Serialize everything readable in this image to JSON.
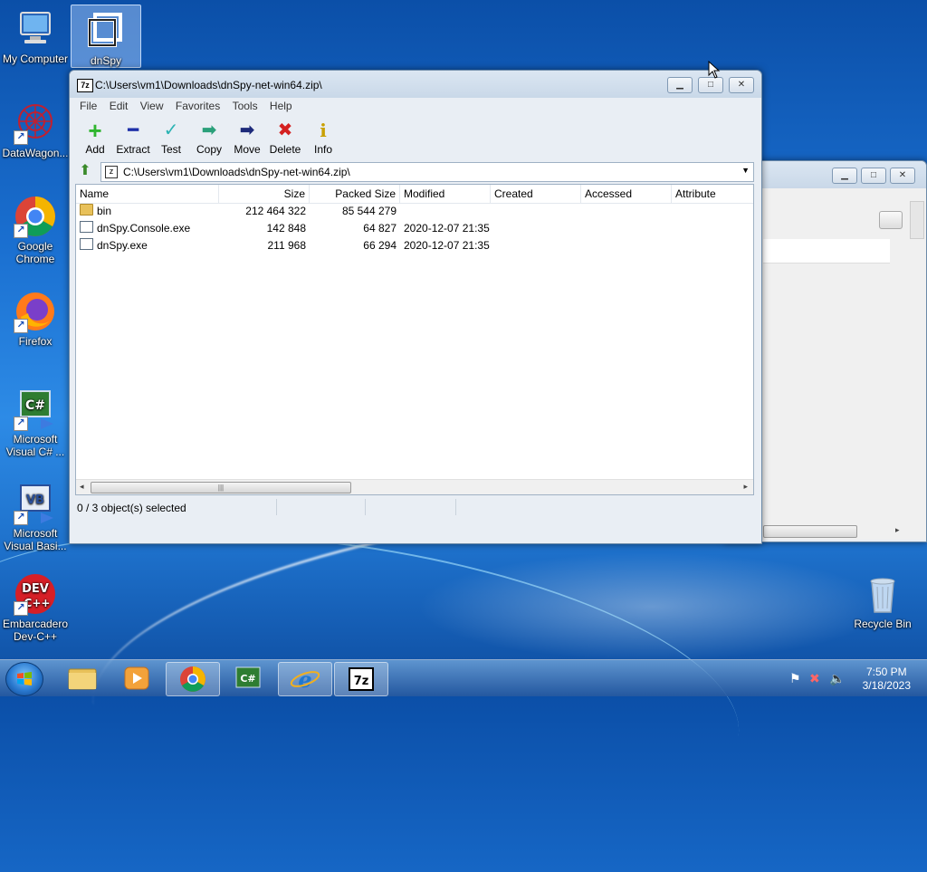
{
  "desktop": {
    "icons": [
      {
        "label": "My Computer"
      },
      {
        "label": "dnSpy"
      },
      {
        "label": "DataWagon..."
      },
      {
        "label": "Google Chrome"
      },
      {
        "label": "Firefox"
      },
      {
        "label": "Microsoft Visual C# ..."
      },
      {
        "label": "Microsoft Visual Basi..."
      },
      {
        "label": "Embarcadero Dev-C++"
      },
      {
        "label": "Recycle Bin"
      }
    ]
  },
  "window": {
    "title": "C:\\Users\\vm1\\Downloads\\dnSpy-net-win64.zip\\",
    "app_icon_text": "7z",
    "menu": [
      "File",
      "Edit",
      "View",
      "Favorites",
      "Tools",
      "Help"
    ],
    "toolbar": [
      {
        "label": "Add",
        "icon": "plus-icon",
        "color": "#2fb52f",
        "glyph": "+"
      },
      {
        "label": "Extract",
        "icon": "minus-icon",
        "color": "#1d2fa8",
        "glyph": "━"
      },
      {
        "label": "Test",
        "icon": "check-icon",
        "color": "#2bb3b3",
        "glyph": "✓"
      },
      {
        "label": "Copy",
        "icon": "copy-arrow-icon",
        "color": "#2aa07a",
        "glyph": "➡"
      },
      {
        "label": "Move",
        "icon": "move-arrow-icon",
        "color": "#1d2a7a",
        "glyph": "➡"
      },
      {
        "label": "Delete",
        "icon": "delete-x-icon",
        "color": "#d42020",
        "glyph": "✖"
      },
      {
        "label": "Info",
        "icon": "info-icon",
        "color": "#c9a000",
        "glyph": "i"
      }
    ],
    "address": "C:\\Users\\vm1\\Downloads\\dnSpy-net-win64.zip\\",
    "columns": [
      "Name",
      "Size",
      "Packed Size",
      "Modified",
      "Created",
      "Accessed",
      "Attribute"
    ],
    "rows": [
      {
        "name": "bin",
        "type": "folder",
        "size": "212 464 322",
        "packed": "85 544 279",
        "modified": ""
      },
      {
        "name": "dnSpy.Console.exe",
        "type": "exe",
        "size": "142 848",
        "packed": "64 827",
        "modified": "2020-12-07 21:35"
      },
      {
        "name": "dnSpy.exe",
        "type": "exe",
        "size": "211 968",
        "packed": "66 294",
        "modified": "2020-12-07 21:35"
      }
    ],
    "status": "0 / 3 object(s) selected"
  },
  "taskbar": {
    "time": "7:50 PM",
    "date": "3/18/2023"
  },
  "colors": {
    "accent": "#2d8be6",
    "selected_icon_bg": "#b4d2ff"
  }
}
